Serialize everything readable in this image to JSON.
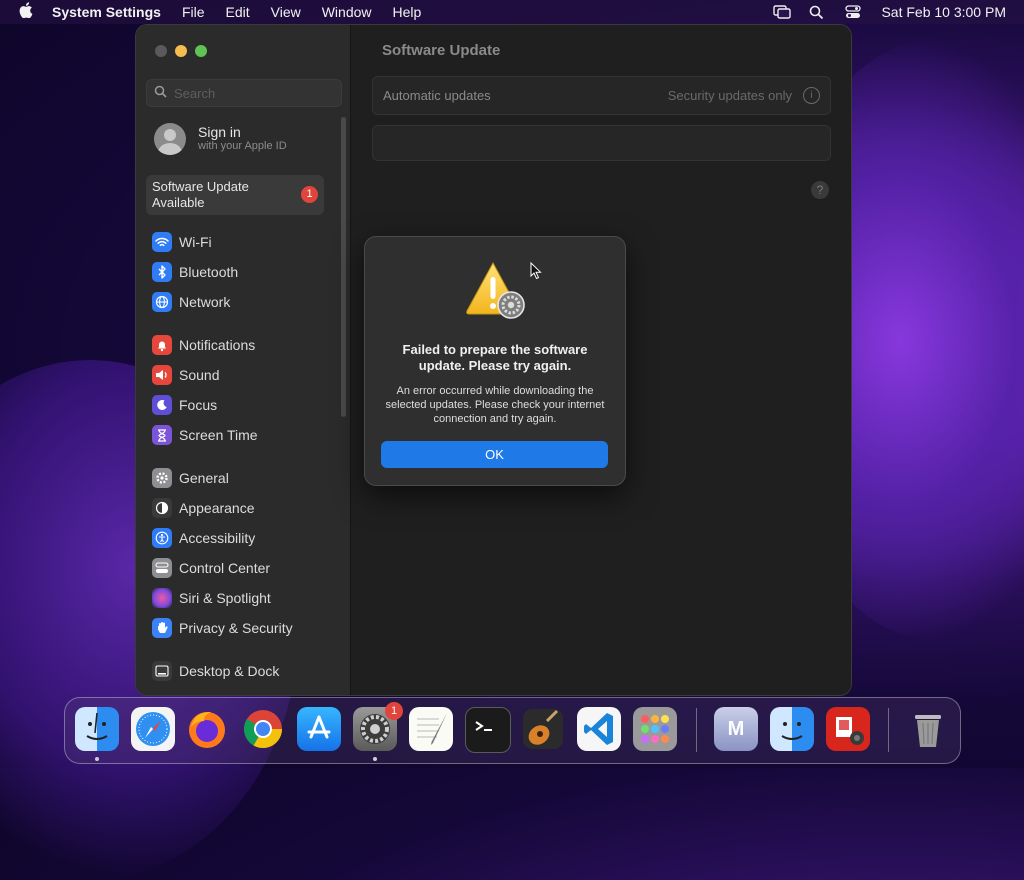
{
  "menubar": {
    "app_name": "System Settings",
    "menus": [
      "File",
      "Edit",
      "View",
      "Window",
      "Help"
    ],
    "datetime": "Sat Feb 10  3:00 PM"
  },
  "sidebar": {
    "search_placeholder": "Search",
    "signin_title": "Sign in",
    "signin_subtitle": "with your Apple ID",
    "update_item": "Software Update Available",
    "update_badge": "1",
    "items": [
      {
        "label": "Wi-Fi",
        "color": "#2f7cf6"
      },
      {
        "label": "Bluetooth",
        "color": "#2f7cf6"
      },
      {
        "label": "Network",
        "color": "#2f7cf6"
      },
      {
        "label": "Notifications",
        "color": "#e5473d"
      },
      {
        "label": "Sound",
        "color": "#e5473d"
      },
      {
        "label": "Focus",
        "color": "#5e4fd6"
      },
      {
        "label": "Screen Time",
        "color": "#7b55d8"
      },
      {
        "label": "General",
        "color": "#8e8e93"
      },
      {
        "label": "Appearance",
        "color": "#3a3a3c"
      },
      {
        "label": "Accessibility",
        "color": "#2f7cf6"
      },
      {
        "label": "Control Center",
        "color": "#8e8e93"
      },
      {
        "label": "Siri & Spotlight",
        "color": "#c640d8"
      },
      {
        "label": "Privacy & Security",
        "color": "#3b82f6"
      },
      {
        "label": "Desktop & Dock",
        "color": "#3a3a3c"
      }
    ]
  },
  "content": {
    "title": "Software Update",
    "auto_updates_label": "Automatic updates",
    "auto_updates_value": "Security updates only",
    "info_glyph": "i",
    "help_glyph": "?"
  },
  "dialog": {
    "title": "Failed to prepare the software update. Please try again.",
    "message": "An error occurred while downloading the selected updates. Please check your internet connection and try again.",
    "ok_label": "OK"
  },
  "dock": {
    "apps": [
      "Finder",
      "Safari",
      "Firefox",
      "Chrome",
      "App Store",
      "System Settings",
      "TextEdit",
      "Terminal",
      "GarageBand",
      "VS Code",
      "Launchpad",
      "M",
      "Finder",
      "Photo Booth",
      "Trash"
    ],
    "settings_badge": "1",
    "m_letter": "M"
  }
}
